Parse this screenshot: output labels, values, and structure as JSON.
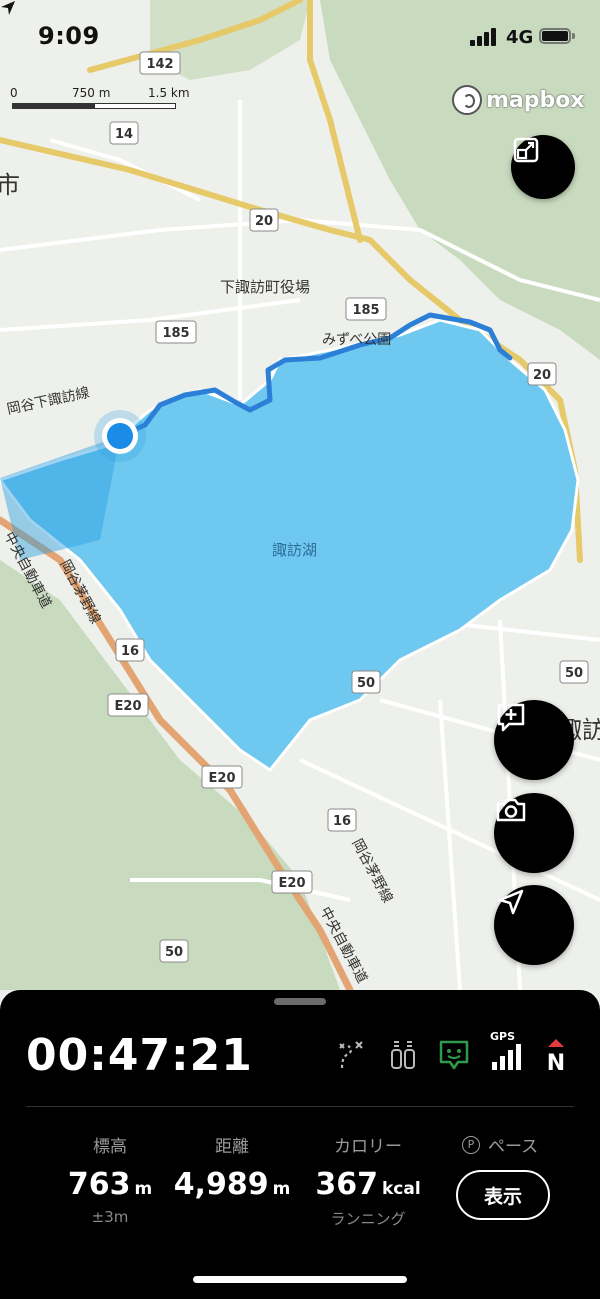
{
  "status_bar": {
    "time": "9:09",
    "network": "4G"
  },
  "map": {
    "scale": {
      "start": "0",
      "mid": "750 m",
      "end": "1.5 km"
    },
    "attribution": "mapbox",
    "labels": {
      "city_fragment": "市",
      "town_hall": "下諏訪町役場",
      "park": "みずべ公園",
      "lake": "諏訪湖",
      "route_okaya_shimosuwa": "岡谷下諏訪線",
      "route_okaya_chino_w": "岡谷茅野線",
      "route_okaya_chino_e": "岡谷茅野線",
      "expressway_w": "中央自動車道",
      "expressway_e": "中央自動車道",
      "suwa_fragment": "諏訪"
    },
    "road_shields": [
      "142",
      "14",
      "20",
      "185",
      "185",
      "20",
      "16",
      "E20",
      "E20",
      "50",
      "16",
      "E20",
      "50",
      "50"
    ],
    "colors": {
      "lake": "#6fc8ef",
      "route": "#2b7fd6",
      "major_road": "#e5c766",
      "expressway": "#e3a473",
      "land": "#eef0ec",
      "forest": "#c7d9bd"
    }
  },
  "buttons": {
    "expand": "expand-icon",
    "add_note": "add-note-icon",
    "camera": "camera-icon",
    "locate": "locate-icon"
  },
  "panel": {
    "elapsed": "00:47:21",
    "gps_label": "GPS",
    "compass_label": "N",
    "stats": {
      "elevation": {
        "label": "標高",
        "value": "763",
        "unit": "m",
        "sub": "±3m"
      },
      "distance": {
        "label": "距離",
        "value": "4,989",
        "unit": "m"
      },
      "calories": {
        "label": "カロリー",
        "value": "367",
        "unit": "kcal",
        "sub": "ランニング"
      },
      "pace": {
        "badge": "P",
        "label": "ペース",
        "button": "表示"
      }
    },
    "indicator_colors": {
      "map_matching": "#2e9b4a",
      "gps": "#ffffff",
      "compass": "#e23b3b"
    }
  }
}
